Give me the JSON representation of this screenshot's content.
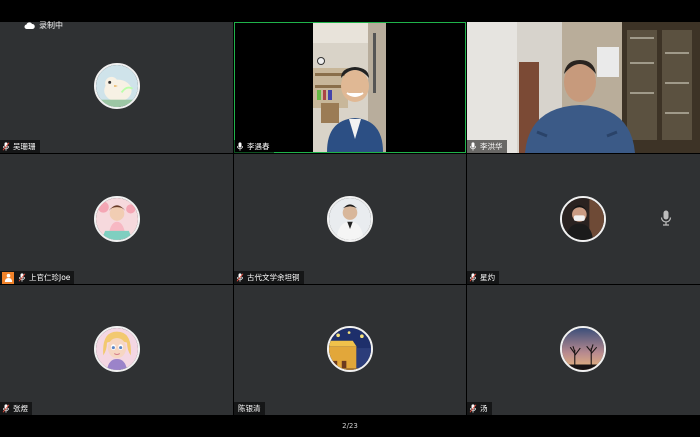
{
  "recording": {
    "label": "录制中"
  },
  "participants": [
    {
      "name": "吴珊珊"
    },
    {
      "name": "李遇春"
    },
    {
      "name": "李洪华"
    },
    {
      "name": "上官仁珍Joe"
    },
    {
      "name": "古代文学余坦铜"
    },
    {
      "name": "星灼"
    },
    {
      "name": "张煜"
    },
    {
      "name": "陈银清"
    },
    {
      "name": "汤"
    }
  ],
  "pager": {
    "text": "2/23"
  },
  "colors": {
    "tile_bg": "#2f3133",
    "active_border": "#1fb24a",
    "host_badge": "#f0822a"
  }
}
